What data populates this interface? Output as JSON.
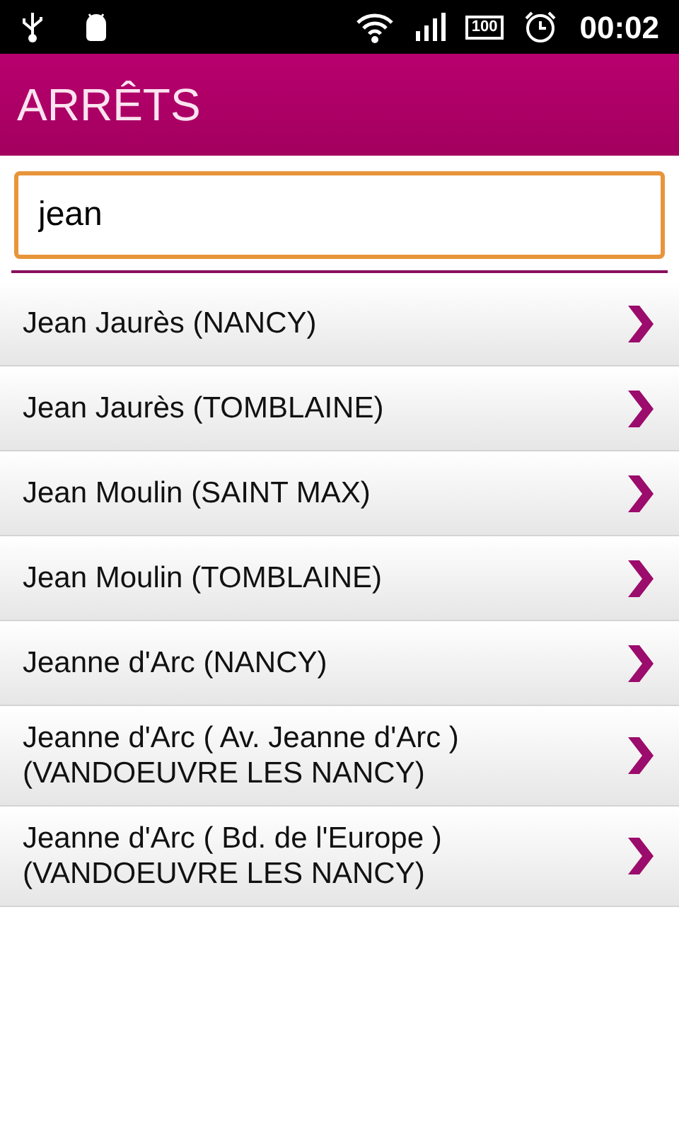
{
  "status_bar": {
    "battery": "100",
    "time": "00:02"
  },
  "header": {
    "title": "ARRÊTS"
  },
  "search": {
    "value": "jean"
  },
  "stops": [
    {
      "label": "Jean Jaurès (NANCY)"
    },
    {
      "label": "Jean Jaurès (TOMBLAINE)"
    },
    {
      "label": "Jean Moulin (SAINT MAX)"
    },
    {
      "label": "Jean Moulin (TOMBLAINE)"
    },
    {
      "label": "Jeanne d'Arc (NANCY)"
    },
    {
      "label": "Jeanne d'Arc ( Av. Jeanne d'Arc )\n(VANDOEUVRE LES NANCY)"
    },
    {
      "label": "Jeanne d'Arc ( Bd. de l'Europe )\n(VANDOEUVRE LES NANCY)"
    }
  ]
}
